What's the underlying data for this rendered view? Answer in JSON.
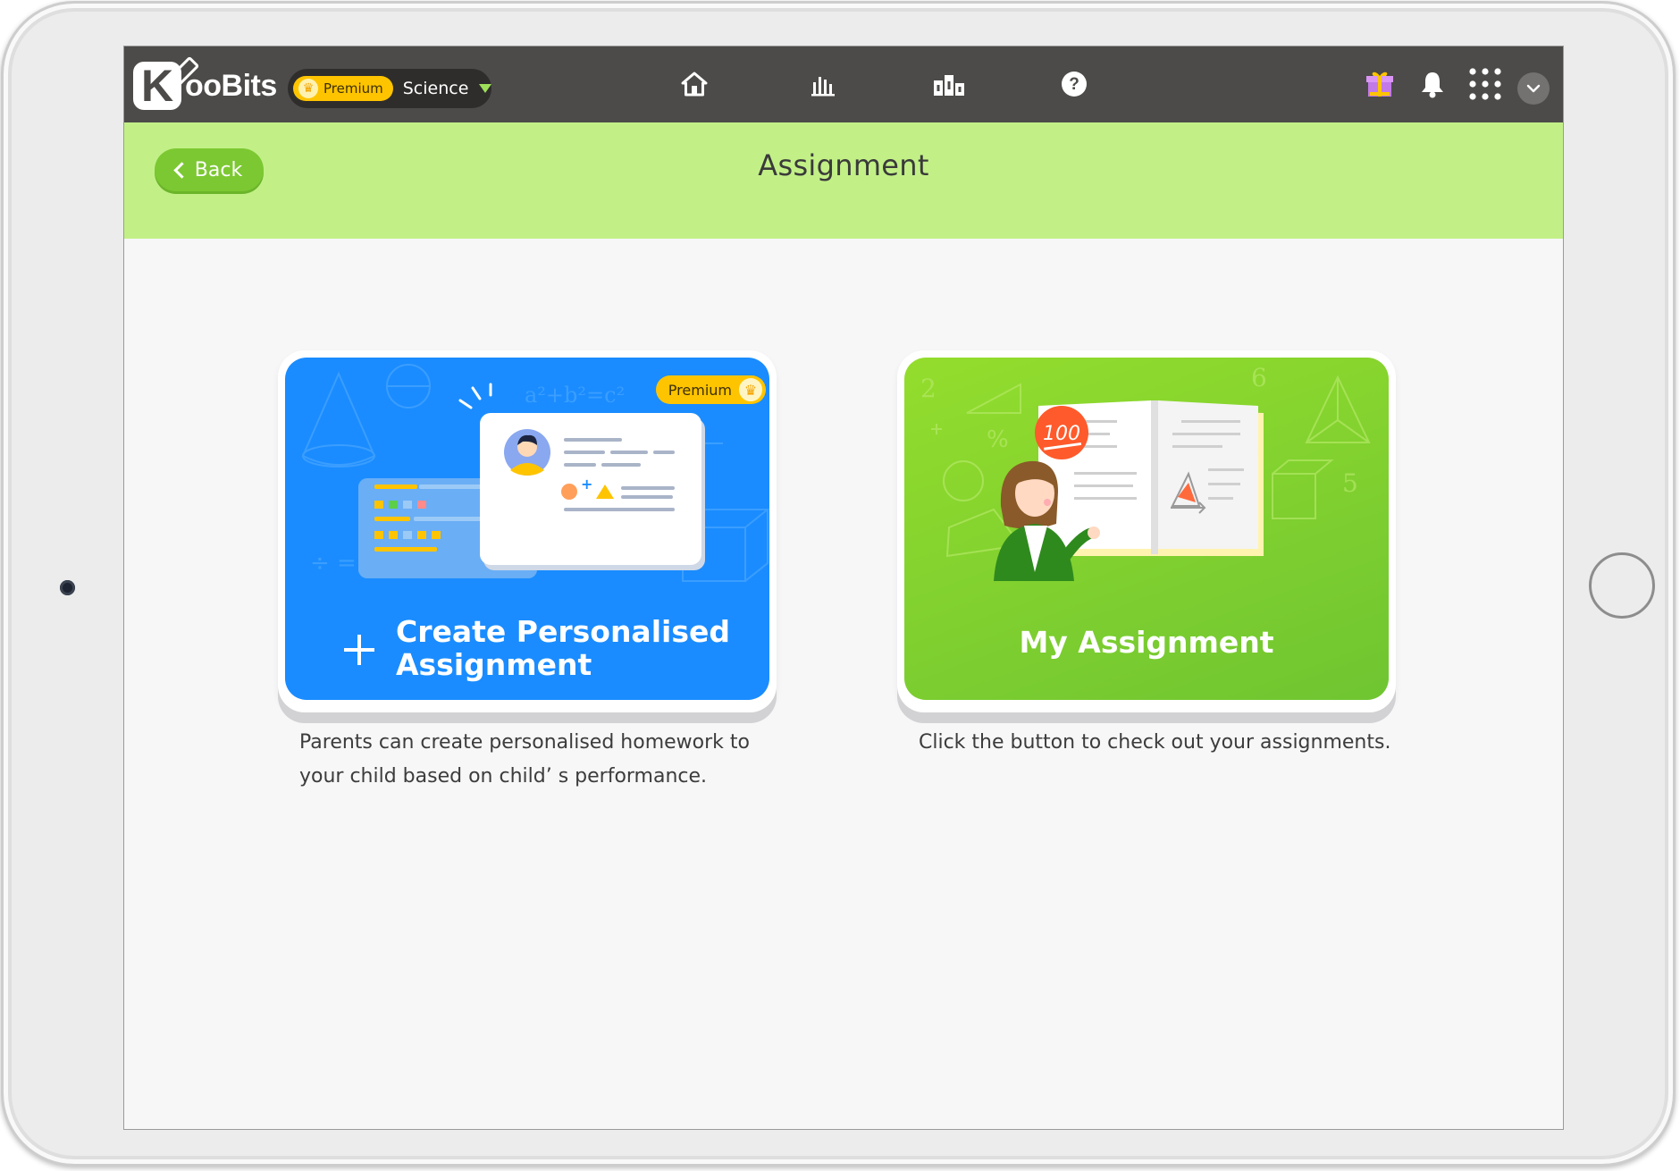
{
  "app": {
    "logo_text": "ooBits",
    "logo_letter": "K",
    "premium_label": "Premium",
    "subject": "Science"
  },
  "nav": [
    {
      "name": "home",
      "icon": "home-icon"
    },
    {
      "name": "reports",
      "icon": "bar-chart-icon"
    },
    {
      "name": "leaderboard",
      "icon": "podium-icon"
    },
    {
      "name": "help",
      "icon": "help-icon"
    }
  ],
  "right_icons": [
    "gift-icon",
    "bell-icon",
    "apps-grid-icon",
    "chevron-down-icon"
  ],
  "header": {
    "back_label": "Back",
    "title": "Assignment"
  },
  "cards": {
    "create": {
      "badge": "Premium",
      "title_line1": "Create Personalised",
      "title_line2": "Assignment",
      "description_line1": "Parents can create personalised homework to",
      "description_line2": "your child based on child’ s performance."
    },
    "mine": {
      "title": "My Assignment",
      "description": "Click the button to check out your assignments.",
      "score_badge": "100"
    }
  },
  "colors": {
    "topbar": "#4d4b49",
    "header": "#c2f087",
    "back_button": "#7cc832",
    "blue_card": "#1a8cff",
    "green_card": "#7fcf2e",
    "premium": "#ffc400"
  }
}
